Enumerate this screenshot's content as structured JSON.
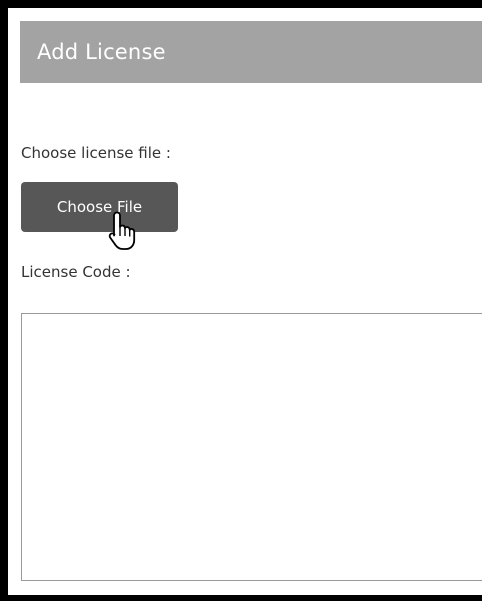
{
  "header": {
    "title": "Add License"
  },
  "form": {
    "file_label": "Choose license file :",
    "choose_file_button": "Choose File",
    "code_label": "License Code :",
    "code_value": "",
    "code_placeholder": ""
  },
  "colors": {
    "header_bg": "#a3a3a3",
    "button_bg": "#575757",
    "frame": "#000000"
  },
  "icons": {
    "cursor": "hand-pointer-icon"
  }
}
